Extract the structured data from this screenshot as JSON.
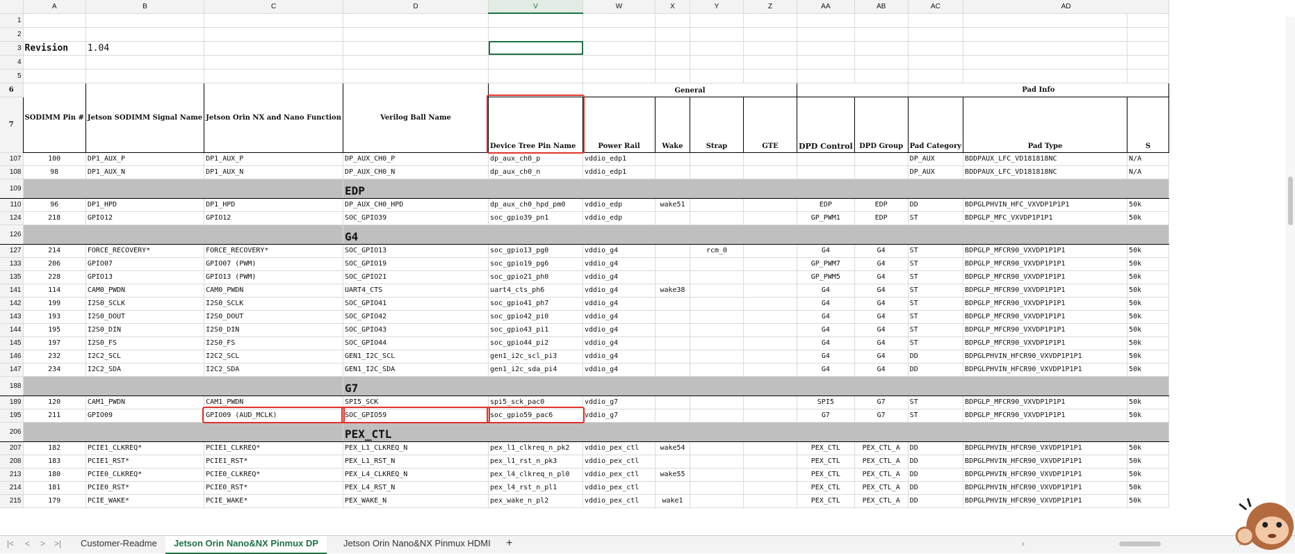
{
  "columns": [
    "A",
    "B",
    "C",
    "D",
    "V",
    "W",
    "X",
    "Y",
    "Z",
    "AA",
    "AB",
    "AC",
    "AD"
  ],
  "selected_column": "V",
  "revision": {
    "label": "Revision",
    "value": "1.04"
  },
  "header": {
    "general": "General",
    "pad_info": "Pad Info",
    "sodimm_pin": "SODIMM Pin #",
    "signal_name": "Jetson SODIMM Signal Name",
    "function": "Jetson Orin NX and Nano Function",
    "verilog": "Verilog Ball Name",
    "dt_pin": "Device Tree Pin Name",
    "power_rail": "Power Rail",
    "wake": "Wake",
    "strap": "Strap",
    "gte": "GTE",
    "dpd_control": "DPD Control",
    "dpd_group": "DPD Group",
    "pad_category": "Pad Category",
    "pad_type": "Pad Type",
    "extra": "S"
  },
  "rows": [
    {
      "type": "data",
      "rn": "107",
      "cells": [
        "100",
        "DP1_AUX_P",
        "DP1_AUX_P",
        "DP_AUX_CH0_P",
        "dp_aux_ch0_p",
        "vddio_edp1",
        "",
        "",
        "",
        "",
        "",
        "DP_AUX",
        "BDDPAUX_LFC_VD181818NC",
        "N/A"
      ]
    },
    {
      "type": "data",
      "rn": "108",
      "cells": [
        "98",
        "DP1_AUX_N",
        "DP1_AUX_N",
        "DP_AUX_CH0_N",
        "dp_aux_ch0_n",
        "vddio_edp1",
        "",
        "",
        "",
        "",
        "",
        "DP_AUX",
        "BDDPAUX_LFC_VD181818NC",
        "N/A"
      ]
    },
    {
      "type": "group",
      "rn": "109",
      "name": "EDP"
    },
    {
      "type": "data",
      "rn": "110",
      "cells": [
        "96",
        "DP1_HPD",
        "DP1_HPD",
        "DP_AUX_CH0_HPD",
        "dp_aux_ch0_hpd_pm0",
        "vddio_edp",
        "wake51",
        "",
        "",
        "EDP",
        "EDP",
        "DD",
        "BDPGLPHVIN_HFC_VXVDP1P1P1",
        "50k"
      ]
    },
    {
      "type": "data",
      "rn": "124",
      "cells": [
        "218",
        "GPIO12",
        "GPIO12",
        "SOC_GPIO39",
        "soc_gpio39_pn1",
        "vddio_edp",
        "",
        "",
        "",
        "GP_PWM1",
        "EDP",
        "ST",
        "BDPGLP_MFC_VXVDP1P1P1",
        "50k"
      ]
    },
    {
      "type": "group",
      "rn": "126",
      "name": "G4"
    },
    {
      "type": "data",
      "rn": "127",
      "cells": [
        "214",
        "FORCE_RECOVERY*",
        "FORCE_RECOVERY*",
        "SOC_GPIO13",
        "soc_gpio13_pg0",
        "vddio_g4",
        "",
        "rcm_0",
        "",
        "G4",
        "G4",
        "ST",
        "BDPGLP_MFCR90_VXVDP1P1P1",
        "50k"
      ]
    },
    {
      "type": "data",
      "rn": "133",
      "cells": [
        "206",
        "GPIO07",
        "GPIO07 (PWM)",
        "SOC_GPIO19",
        "soc_gpio19_pg6",
        "vddio_g4",
        "",
        "",
        "",
        "GP_PWM7",
        "G4",
        "ST",
        "BDPGLP_MFCR90_VXVDP1P1P1",
        "50k"
      ]
    },
    {
      "type": "data",
      "rn": "135",
      "cells": [
        "228",
        "GPIO13",
        "GPIO13 (PWM)",
        "SOC_GPIO21",
        "soc_gpio21_ph0",
        "vddio_g4",
        "",
        "",
        "",
        "GP_PWM5",
        "G4",
        "ST",
        "BDPGLP_MFCR90_VXVDP1P1P1",
        "50k"
      ]
    },
    {
      "type": "data",
      "rn": "141",
      "cells": [
        "114",
        "CAM0_PWDN",
        "CAM0_PWDN",
        "UART4_CTS",
        "uart4_cts_ph6",
        "vddio_g4",
        "wake38",
        "",
        "",
        "G4",
        "G4",
        "ST",
        "BDPGLP_MFCR90_VXVDP1P1P1",
        "50k"
      ]
    },
    {
      "type": "data",
      "rn": "142",
      "cells": [
        "199",
        "I2S0_SCLK",
        "I2S0_SCLK",
        "SOC_GPIO41",
        "soc_gpio41_ph7",
        "vddio_g4",
        "",
        "",
        "",
        "G4",
        "G4",
        "ST",
        "BDPGLP_MFCR90_VXVDP1P1P1",
        "50k"
      ]
    },
    {
      "type": "data",
      "rn": "143",
      "cells": [
        "193",
        "I2S0_DOUT",
        "I2S0_DOUT",
        "SOC_GPIO42",
        "soc_gpio42_pi0",
        "vddio_g4",
        "",
        "",
        "",
        "G4",
        "G4",
        "ST",
        "BDPGLP_MFCR90_VXVDP1P1P1",
        "50k"
      ]
    },
    {
      "type": "data",
      "rn": "144",
      "cells": [
        "195",
        "I2S0_DIN",
        "I2S0_DIN",
        "SOC_GPIO43",
        "soc_gpio43_pi1",
        "vddio_g4",
        "",
        "",
        "",
        "G4",
        "G4",
        "ST",
        "BDPGLP_MFCR90_VXVDP1P1P1",
        "50k"
      ]
    },
    {
      "type": "data",
      "rn": "145",
      "cells": [
        "197",
        "I2S0_FS",
        "I2S0_FS",
        "SOC_GPIO44",
        "soc_gpio44_pi2",
        "vddio_g4",
        "",
        "",
        "",
        "G4",
        "G4",
        "ST",
        "BDPGLP_MFCR90_VXVDP1P1P1",
        "50k"
      ]
    },
    {
      "type": "data",
      "rn": "146",
      "cells": [
        "232",
        "I2C2_SCL",
        "I2C2_SCL",
        "GEN1_I2C_SCL",
        "gen1_i2c_scl_pi3",
        "vddio_g4",
        "",
        "",
        "",
        "G4",
        "G4",
        "DD",
        "BDPGLPHVIN_HFCR90_VXVDP1P1P1",
        "50k"
      ]
    },
    {
      "type": "data",
      "rn": "147",
      "cells": [
        "234",
        "I2C2_SDA",
        "I2C2_SDA",
        "GEN1_I2C_SDA",
        "gen1_i2c_sda_pi4",
        "vddio_g4",
        "",
        "",
        "",
        "G4",
        "G4",
        "DD",
        "BDPGLPHVIN_HFCR90_VXVDP1P1P1",
        "50k"
      ]
    },
    {
      "type": "group",
      "rn": "188",
      "name": "G7"
    },
    {
      "type": "data",
      "rn": "189",
      "cells": [
        "120",
        "CAM1_PWDN",
        "CAM1_PWDN",
        "SPI5_SCK",
        "spi5_sck_pac0",
        "vddio_g7",
        "",
        "",
        "",
        "SPI5",
        "G7",
        "ST",
        "BDPGLP_MFCR90_VXVDP1P1P1",
        "50k"
      ]
    },
    {
      "type": "data",
      "rn": "195",
      "cells": [
        "211",
        "GPIO09",
        "GPIO09 (AUD_MCLK)",
        "SOC_GPIO59",
        "soc_gpio59_pac6",
        "vddio_g7",
        "",
        "",
        "",
        "G7",
        "G7",
        "ST",
        "BDPGLP_MFCR90_VXVDP1P1P1",
        "50k"
      ]
    },
    {
      "type": "group",
      "rn": "206",
      "name": "PEX_CTL"
    },
    {
      "type": "data",
      "rn": "207",
      "cells": [
        "182",
        "PCIE1_CLKREQ*",
        "PCIE1_CLKREQ*",
        "PEX_L1_CLKREQ_N",
        "pex_l1_clkreq_n_pk2",
        "vddio_pex_ctl",
        "wake54",
        "",
        "",
        "PEX_CTL",
        "PEX_CTL_A",
        "DD",
        "BDPGLPHVIN_HFCR90_VXVDP1P1P1",
        "50k"
      ]
    },
    {
      "type": "data",
      "rn": "208",
      "cells": [
        "183",
        "PCIE1_RST*",
        "PCIE1_RST*",
        "PEX_L1_RST_N",
        "pex_l1_rst_n_pk3",
        "vddio_pex_ctl",
        "",
        "",
        "",
        "PEX_CTL",
        "PEX_CTL_A",
        "DD",
        "BDPGLPHVIN_HFCR90_VXVDP1P1P1",
        "50k"
      ]
    },
    {
      "type": "data",
      "rn": "213",
      "cells": [
        "180",
        "PCIE0_CLKREQ*",
        "PCIE0_CLKREQ*",
        "PEX_L4_CLKREQ_N",
        "pex_l4_clkreq_n_pl0",
        "vddio_pex_ctl",
        "wake55",
        "",
        "",
        "PEX_CTL",
        "PEX_CTL_A",
        "DD",
        "BDPGLPHVIN_HFCR90_VXVDP1P1P1",
        "50k"
      ]
    },
    {
      "type": "data",
      "rn": "214",
      "cells": [
        "181",
        "PCIE0_RST*",
        "PCIE0_RST*",
        "PEX_L4_RST_N",
        "pex_l4_rst_n_pl1",
        "vddio_pex_ctl",
        "",
        "",
        "",
        "PEX_CTL",
        "PEX_CTL_A",
        "DD",
        "BDPGLPHVIN_HFCR90_VXVDP1P1P1",
        "50k"
      ]
    },
    {
      "type": "data",
      "rn": "215",
      "cells": [
        "179",
        "PCIE_WAKE*",
        "PCIE_WAKE*",
        "PEX_WAKE_N",
        "pex_wake_n_pl2",
        "vddio_pex_ctl",
        "wake1",
        "",
        "",
        "PEX_CTL",
        "PEX_CTL_A",
        "DD",
        "BDPGLPHVIN_HFCR90_VXVDP1P1P1",
        "50k"
      ]
    }
  ],
  "tabs": [
    "Customer-Readme",
    "Jetson Orin Nano&NX Pinmux DP",
    "Jetson Orin Nano&NX Pinmux HDMI"
  ],
  "active_tab": 1,
  "nav_icons": [
    "first-sheet-icon",
    "prev-sheet-icon",
    "next-sheet-icon",
    "last-sheet-icon"
  ]
}
